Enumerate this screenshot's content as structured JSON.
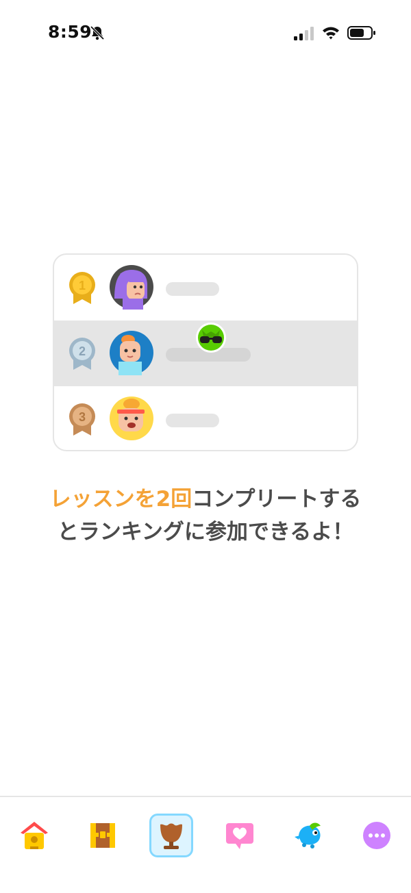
{
  "status_bar": {
    "time": "8:59",
    "icons": [
      "bell-off-icon",
      "cellular-signal-icon",
      "wifi-icon",
      "battery-icon"
    ]
  },
  "leaderboard": {
    "rows": [
      {
        "rank": "1",
        "medal": "gold-medal-icon",
        "avatar": "purple-hair-avatar"
      },
      {
        "rank": "2",
        "medal": "silver-medal-icon",
        "avatar": "blue-avatar",
        "badge": "sunglasses-owl-icon"
      },
      {
        "rank": "3",
        "medal": "bronze-medal-icon",
        "avatar": "yellow-headband-avatar"
      }
    ]
  },
  "message": {
    "highlight": "レッスンを2回",
    "line1_rest": "コンプリートする",
    "line2": "とランキングに参加できるよ！"
  },
  "nav": {
    "items": [
      "home-icon",
      "treasure-chest-icon",
      "trophy-icon",
      "heart-chat-icon",
      "bird-icon",
      "more-icon"
    ],
    "active": "trophy-icon"
  },
  "colors": {
    "highlight": "#f4a236",
    "text": "#4b4b4b",
    "active_border": "#84d8ff",
    "active_bg": "#ddf4ff"
  }
}
